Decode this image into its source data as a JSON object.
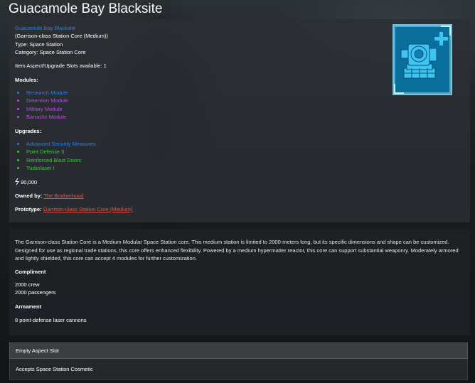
{
  "page_title": "Guacamole Bay Blacksite",
  "info": {
    "name": "Guacamole Bay Blacksite",
    "class_line": "(Garrison-class Station Core (Medium))",
    "type_line": "Type: Space Station",
    "category_line": "Category: Space Station Core",
    "slots_line": "Item Aspect/Upgrade Slots available: 1"
  },
  "modules": {
    "heading": "Modules:",
    "items": [
      "Research Module",
      "Detention Module",
      "Military Module",
      "Barracks Module"
    ]
  },
  "upgrades": {
    "heading": "Upgrades:",
    "items": [
      "Advanced Security Measures",
      "Point Defense II",
      "Reinforced Blast Doors",
      "Turbolaser I"
    ]
  },
  "price": "90,000",
  "owner": {
    "label": "Owned by:",
    "value": "The Brotherhood"
  },
  "prototype": {
    "label": "Prototype:",
    "value": "Garrison-class Station Core (Medium)"
  },
  "description": "The Garrison-class Station Core is a Medium Modular Space Station core. This medium station is limited to 2000-meters long, but its specific dimensions and shape can be customized. Designed for use as regional trade stations, this core offers enhanced flexibility. Powered by a medium hypermatter reactor, this core can support substantial weaponry. Moderately armored and lightly shielded, this core can accept 4 modules for further customization.",
  "compliment": {
    "heading": "Compliment",
    "lines": [
      "2000 crew",
      "2000 passengers"
    ]
  },
  "armament": {
    "heading": "Armament",
    "lines": [
      "8 point-defense laser cannons"
    ]
  },
  "aspect_slot": {
    "title": "Empty Aspect Slot",
    "body": "Accepts Space Station Cosmetic"
  },
  "colors": {
    "link_blue": "#2f7fe2",
    "module_purple": "#b24fe0",
    "upgrade_green": "#2ed12e",
    "link_red": "#d85a4a"
  },
  "icons": {
    "credits": "credits-icon",
    "thumbnail": "station-core-icon",
    "plus": "plus-icon"
  }
}
